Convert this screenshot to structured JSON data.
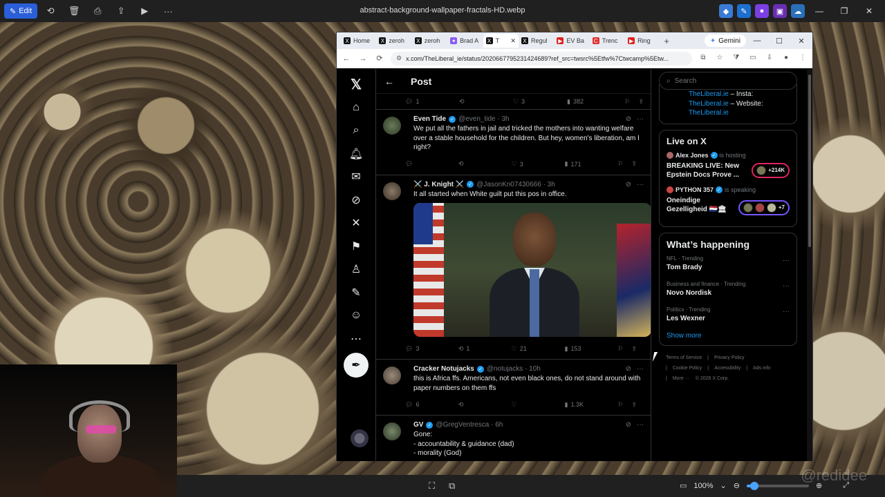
{
  "viewer": {
    "edit_label": "Edit",
    "file_title": "abstract-background-wallpaper-fractals-HD.webp",
    "zoom": "100%",
    "zoom_level": 0.12
  },
  "browser": {
    "tabs": [
      {
        "label": "Home"
      },
      {
        "label": "zeroh"
      },
      {
        "label": "zeroh"
      },
      {
        "label": "Brad A"
      },
      {
        "label": "T"
      },
      {
        "label": "Regul"
      },
      {
        "label": "EV Ba"
      },
      {
        "label": "Trenc"
      },
      {
        "label": "Ring"
      }
    ],
    "gemini_label": "Gemini",
    "url": "x.com/TheLiberal_ie/status/2020667795231424689?ref_src=twsrc%5Etfw%7Ctwcamp%5Etw..."
  },
  "feed": {
    "title": "Post",
    "top_actions": {
      "replies": "1",
      "reposts": "",
      "likes": "3",
      "views": "382"
    },
    "tweets": [
      {
        "name": "Even Tide",
        "handle": "@even_tide · 3h",
        "text": "We put all the fathers in jail and tricked the mothers into wanting welfare over a stable household for the children. But hey, women's liberation, am I right?",
        "replies": "",
        "reposts": "",
        "likes": "3",
        "views": "171"
      },
      {
        "name": "⚔️ J. Knight ⚔️",
        "handle": "@JasonKn07430666 · 3h",
        "text": "It all started when White guilt put this pos in office.",
        "replies": "3",
        "reposts": "1",
        "likes": "21",
        "views": "153"
      },
      {
        "name": "Cracker Notujacks",
        "handle": "@notujacks · 10h",
        "text": "this is Africa ffs. Americans, not even black ones, do not stand around with paper numbers on them ffs",
        "replies": "6",
        "reposts": "",
        "likes": "",
        "views": "1.3K"
      },
      {
        "name": "GV",
        "handle": "@GregVentresca · 6h",
        "text": "Gone:\n- accountability & guidance (dad)\n- morality (God)"
      }
    ]
  },
  "sidebar": {
    "search_placeholder": "Search",
    "links": [
      "TheLiberal.ie",
      " – Insta:",
      "TheLiberal.ie",
      " – Website:",
      "TheLiberal.ie"
    ],
    "live_title": "Live on X",
    "live": [
      {
        "name": "Alex Jones",
        "status": "is hosting",
        "title": "BREAKING LIVE: New Epstein Docs Prove ...",
        "count": "+214K"
      },
      {
        "name": "PYTHON 357",
        "status": "is speaking",
        "title": "Oneindige Gezelligheid 🇳🇱🏛",
        "count": "+7"
      }
    ],
    "happening_title": "What’s happening",
    "trends": [
      {
        "meta": "NFL · Trending",
        "name": "Tom Brady"
      },
      {
        "meta": "Business and finance · Trending",
        "name": "Novo Nordisk"
      },
      {
        "meta": "Politics · Trending",
        "name": "Les Wexner"
      }
    ],
    "show_more": "Show more",
    "footer": [
      "Terms of Service",
      "|",
      "Privacy Policy",
      "|",
      "Cookie Policy",
      "|",
      "Accessibility",
      "|",
      "Ads info",
      "|",
      "More ···",
      "© 2026 X Corp."
    ]
  },
  "watermark": "@redidee",
  "colors": {
    "accent": "#1d9bf0",
    "bg": "#000000",
    "text": "#e7e9ea",
    "muted": "#71767b"
  }
}
